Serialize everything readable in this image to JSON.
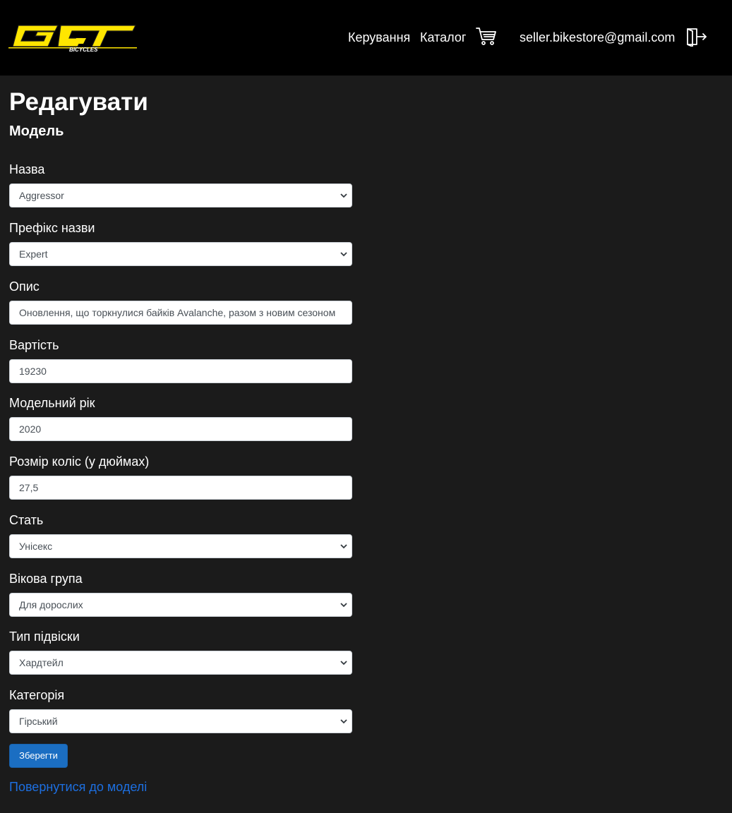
{
  "navbar": {
    "brand_text": "BICYCLES",
    "manage_label": "Керування",
    "catalog_label": "Каталог",
    "cart_icon": "cart-icon",
    "user_email": "seller.bikestore@gmail.com",
    "logout_icon": "logout-icon",
    "brand_color": "#ffe600"
  },
  "page": {
    "title": "Редагувати",
    "subtitle": "Модель"
  },
  "form": {
    "fields": [
      {
        "label": "Назва",
        "value": "Aggressor",
        "type": "select"
      },
      {
        "label": "Префікс назви",
        "value": "Expert",
        "type": "select"
      },
      {
        "label": "Опис",
        "value": "Оновлення, що торкнулися байків Avalanche, разом з новим сезоном",
        "type": "input"
      },
      {
        "label": "Вартість",
        "value": "19230",
        "type": "input"
      },
      {
        "label": "Модельний рік",
        "value": "2020",
        "type": "input"
      },
      {
        "label": "Розмір коліс (у дюймах)",
        "value": "27,5",
        "type": "input"
      },
      {
        "label": "Стать",
        "value": "Унісекс",
        "type": "select"
      },
      {
        "label": "Вікова група",
        "value": "Для дорослих",
        "type": "select"
      },
      {
        "label": "Тип підвіски",
        "value": "Хардтейл",
        "type": "select"
      },
      {
        "label": "Категорія",
        "value": "Гірський",
        "type": "select"
      }
    ],
    "save_label": "Зберегти",
    "back_link": "Повернутися до моделі"
  },
  "colors": {
    "background": "#1b1b1b",
    "navbar": "#000000",
    "primary_button": "#1b6ec2",
    "link": "#1d6fe0"
  }
}
